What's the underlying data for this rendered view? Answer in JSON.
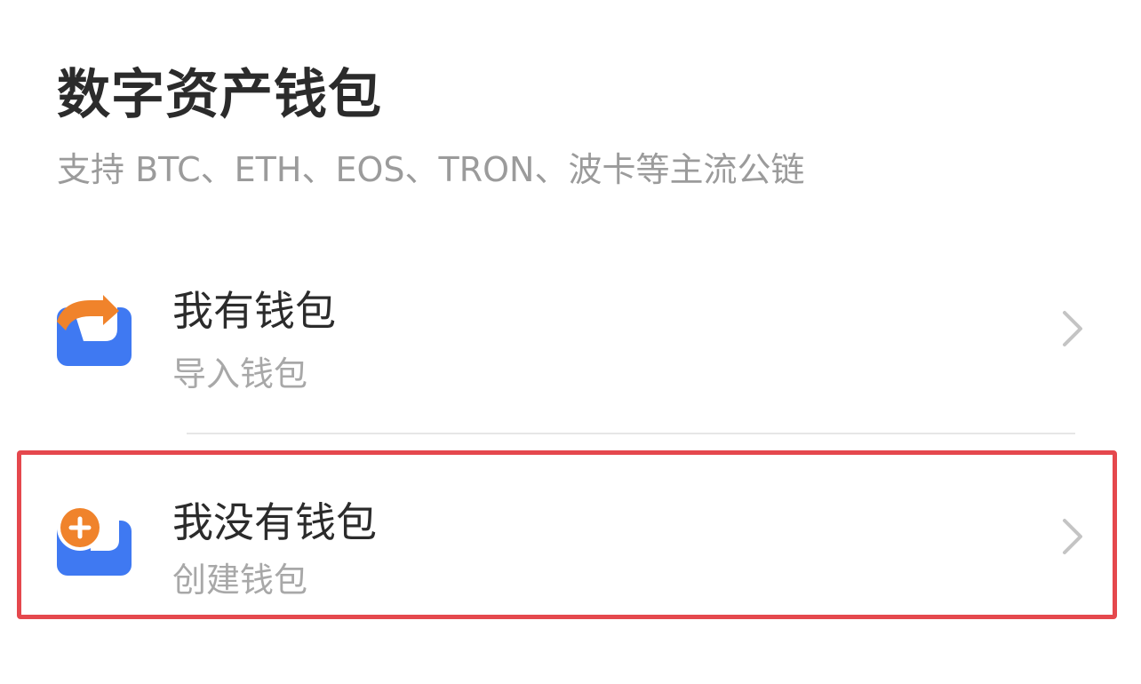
{
  "page": {
    "title": "数字资产钱包",
    "subtitle": "支持 BTC、ETH、EOS、TRON、波卡等主流公链"
  },
  "options": [
    {
      "title": "我有钱包",
      "subtitle": "导入钱包",
      "icon": "import-wallet-icon"
    },
    {
      "title": "我没有钱包",
      "subtitle": "创建钱包",
      "icon": "create-wallet-icon"
    }
  ],
  "colors": {
    "wallet_blue": "#3f79f2",
    "accent_orange": "#f0832b",
    "highlight_red": "#e5484d",
    "title_text": "#2b2b2b",
    "secondary_text": "#9b9b9b",
    "divider": "#e6e6e6",
    "chevron": "#c4c4c4"
  }
}
